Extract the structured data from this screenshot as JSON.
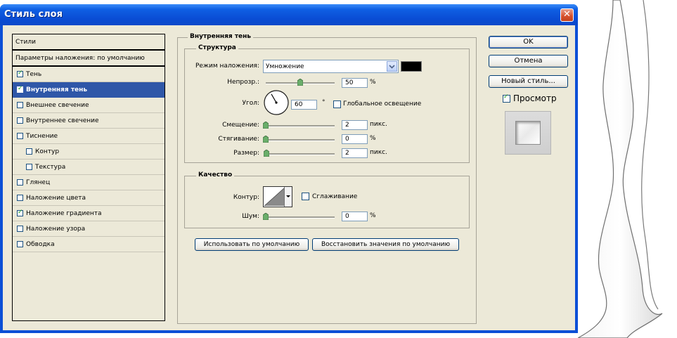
{
  "window": {
    "title": "Стиль слоя",
    "close_glyph": "✕"
  },
  "styles_list": {
    "header": "Стили",
    "items": [
      {
        "label": "Параметры наложения: по умолчанию",
        "checkbox": false,
        "checked": false,
        "selected": false,
        "indent": false
      },
      {
        "label": "Тень",
        "checkbox": true,
        "checked": true,
        "selected": false,
        "indent": false
      },
      {
        "label": "Внутренняя тень",
        "checkbox": true,
        "checked": true,
        "selected": true,
        "indent": false
      },
      {
        "label": "Внешнее свечение",
        "checkbox": true,
        "checked": false,
        "selected": false,
        "indent": false
      },
      {
        "label": "Внутреннее свечение",
        "checkbox": true,
        "checked": false,
        "selected": false,
        "indent": false
      },
      {
        "label": "Тиснение",
        "checkbox": true,
        "checked": false,
        "selected": false,
        "indent": false
      },
      {
        "label": "Контур",
        "checkbox": true,
        "checked": false,
        "selected": false,
        "indent": true
      },
      {
        "label": "Текстура",
        "checkbox": true,
        "checked": false,
        "selected": false,
        "indent": true
      },
      {
        "label": "Глянец",
        "checkbox": true,
        "checked": false,
        "selected": false,
        "indent": false
      },
      {
        "label": "Наложение цвета",
        "checkbox": true,
        "checked": false,
        "selected": false,
        "indent": false
      },
      {
        "label": "Наложение градиента",
        "checkbox": true,
        "checked": true,
        "selected": false,
        "indent": false
      },
      {
        "label": "Наложение узора",
        "checkbox": true,
        "checked": false,
        "selected": false,
        "indent": false
      },
      {
        "label": "Обводка",
        "checkbox": true,
        "checked": false,
        "selected": false,
        "indent": false
      }
    ]
  },
  "panel": {
    "title": "Внутренняя тень",
    "structure": {
      "title": "Структура",
      "blend_mode_label": "Режим наложения:",
      "blend_mode_value": "Умножение",
      "shadow_color": "#000000",
      "opacity_label": "Непрозр.:",
      "opacity_value": "50",
      "opacity_unit": "%",
      "opacity_percent": 50,
      "angle_label": "Угол:",
      "angle_value": "60",
      "angle_unit": "°",
      "angle_degrees": 60,
      "global_light_label": "Глобальное освещение",
      "global_light_checked": false,
      "distance_label": "Смещение:",
      "distance_value": "2",
      "distance_unit": "пикс.",
      "choke_label": "Стягивание:",
      "choke_value": "0",
      "choke_unit": "%",
      "size_label": "Размер:",
      "size_value": "2",
      "size_unit": "пикс."
    },
    "quality": {
      "title": "Качество",
      "contour_label": "Контур:",
      "antialias_label": "Сглаживание",
      "antialias_checked": false,
      "noise_label": "Шум:",
      "noise_value": "0",
      "noise_unit": "%"
    },
    "make_default_label": "Использовать по умолчанию",
    "reset_default_label": "Восстановить значения по умолчанию"
  },
  "buttons": {
    "ok": "OK",
    "cancel": "Отмена",
    "new_style": "Новый стиль...",
    "preview_label": "Просмотр",
    "preview_checked": true
  },
  "colors": {
    "titlebar": "#0a4cd4",
    "selection": "#2f57a8",
    "dialog_bg": "#ece9d8"
  }
}
